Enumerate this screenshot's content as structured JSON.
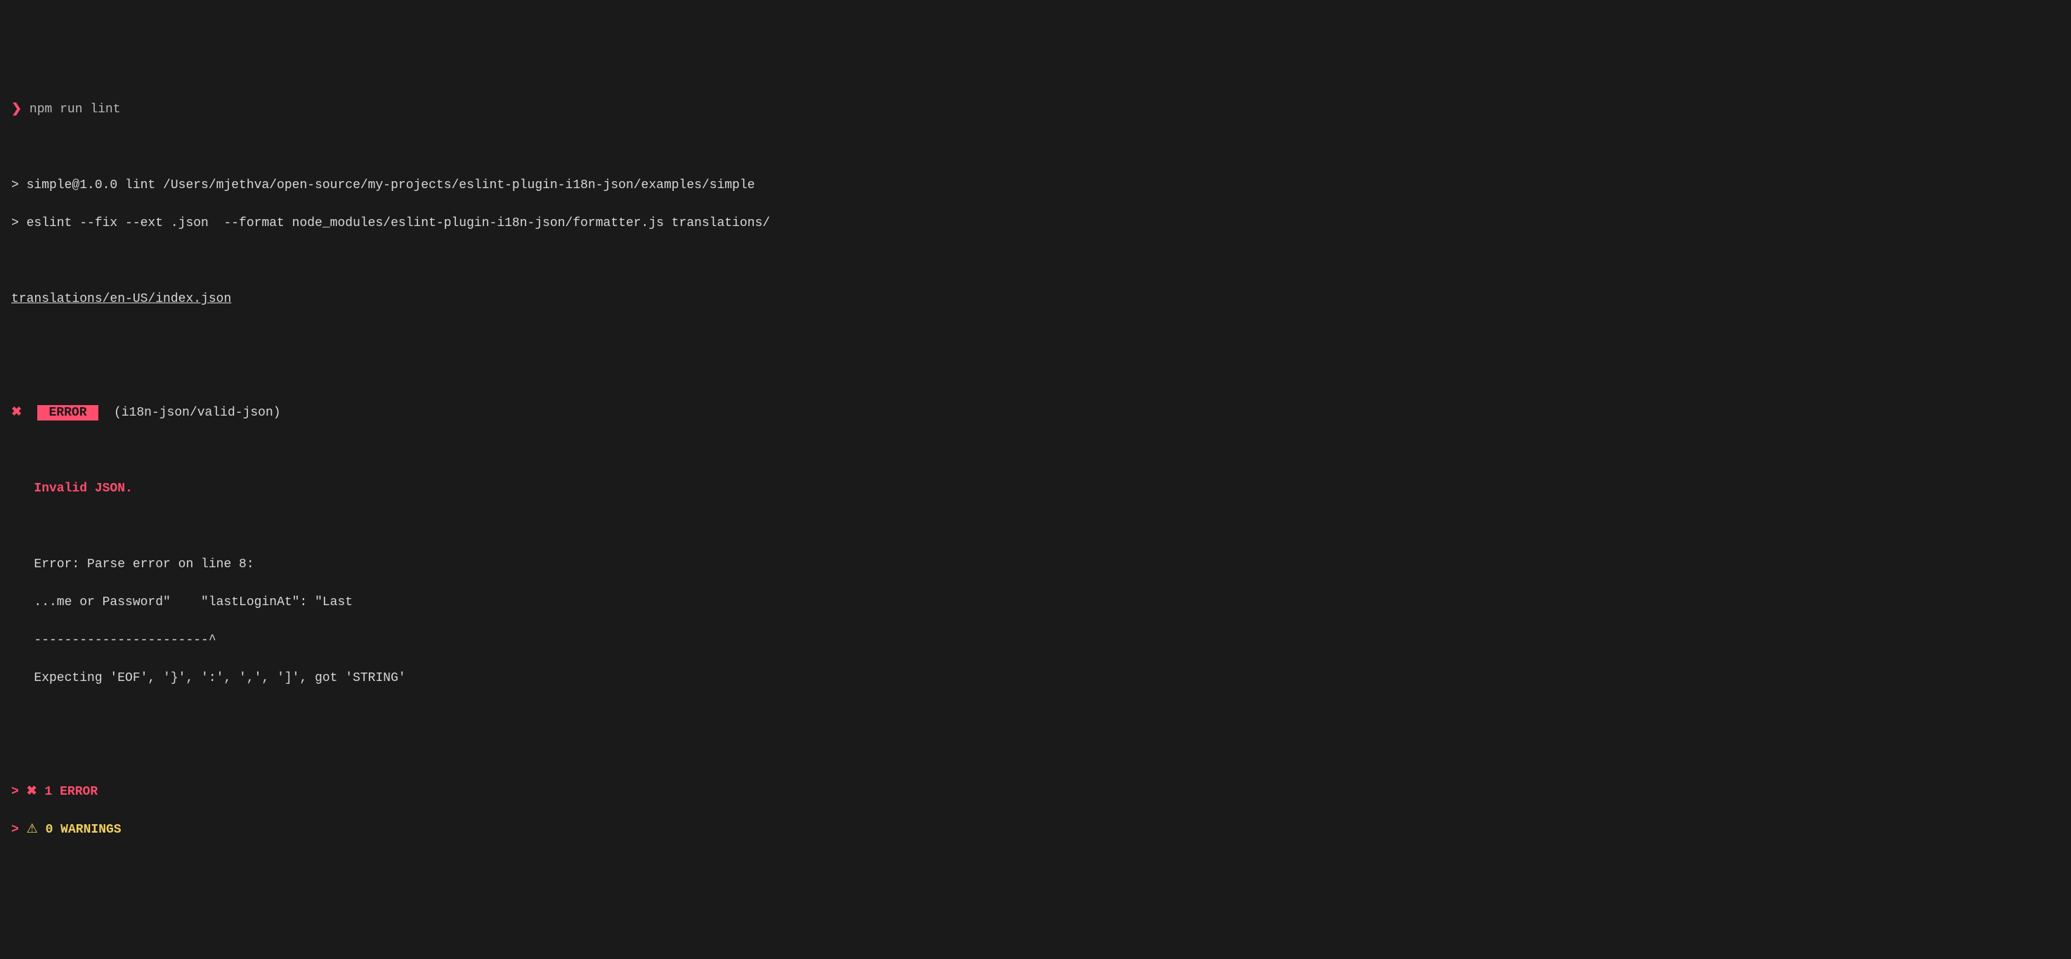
{
  "terminal": {
    "prompt_symbol": "❯",
    "command": "npm run lint",
    "script_line1": "> simple@1.0.0 lint /Users/mjethva/open-source/my-projects/eslint-plugin-i18n-json/examples/simple",
    "script_line2": "> eslint --fix --ext .json  --format node_modules/eslint-plugin-i18n-json/formatter.js translations/",
    "file_path": "translations/en-US/index.json",
    "error": {
      "cross": "✖",
      "badge": " ERROR ",
      "rule": "(i18n-json/valid-json)",
      "title": "Invalid JSON.",
      "detail_line1": "Error: Parse error on line 8:",
      "detail_line2": "...me or Password\"    \"lastLoginAt\": \"Last",
      "detail_line3": "-----------------------^",
      "detail_line4": "Expecting 'EOF', '}', ':', ',', ']', got 'STRING'"
    },
    "summary": {
      "prompt": ">",
      "error_cross": "✖",
      "error_count": "1 ERROR",
      "warning_symbol": "⚠",
      "warning_count": "0 WARNINGS"
    }
  }
}
